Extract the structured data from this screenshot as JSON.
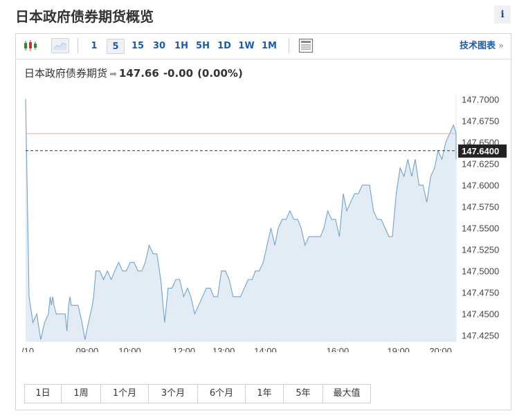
{
  "header": {
    "title": "日本政府债券期货概览",
    "info_label": "i"
  },
  "toolbar": {
    "timeframes": [
      "1",
      "5",
      "15",
      "30",
      "1H",
      "5H",
      "1D",
      "1W",
      "1M"
    ],
    "active_timeframe": "5",
    "tech_chart_label": "技术图表",
    "tech_chart_arrow": "»"
  },
  "quote": {
    "name": "日本政府债券期货",
    "arrow": "➡",
    "price": "147.66",
    "change": "-0.00",
    "change_pct": "(0.00%)"
  },
  "ranges": [
    "1日",
    "1周",
    "1个月",
    "3个月",
    "6个月",
    "1年",
    "5年",
    "最大值"
  ],
  "colors": {
    "line": "#6fa3cc",
    "area": "#e3ecf5",
    "prev_close_line": "#f3a5a5",
    "current_line": "#333333",
    "current_badge_bg": "#222222",
    "accent": "#1d5aa8"
  },
  "chart_data": {
    "type": "area",
    "y_ticks": [
      "147.7000",
      "147.6750",
      "147.6500",
      "147.6250",
      "147.6000",
      "147.5750",
      "147.5500",
      "147.5250",
      "147.5000",
      "147.4750",
      "147.4500",
      "147.4250"
    ],
    "x_ticks": [
      {
        "label": "/10",
        "t": 0
      },
      {
        "label": "09:00",
        "t": 14.3
      },
      {
        "label": "10:00",
        "t": 24.2
      },
      {
        "label": "12:00",
        "t": 36.8
      },
      {
        "label": "13:00",
        "t": 46.0
      },
      {
        "label": "14:00",
        "t": 55.7
      },
      {
        "label": "16:00",
        "t": 72.5
      },
      {
        "label": "19:00",
        "t": 86.6
      },
      {
        "label": "20:00",
        "t": 96.4
      }
    ],
    "ylim": [
      147.4175,
      147.7051
    ],
    "xlim": [
      0,
      100
    ],
    "current_value": 147.64,
    "current_label": "147.6400",
    "prev_close": 147.66,
    "values": [
      [
        0,
        147.7
      ],
      [
        0.8,
        147.47
      ],
      [
        1.7,
        147.44
      ],
      [
        2.6,
        147.45
      ],
      [
        3.5,
        147.42
      ],
      [
        4.4,
        147.44
      ],
      [
        5.3,
        147.45
      ],
      [
        5.7,
        147.47
      ],
      [
        6.0,
        147.46
      ],
      [
        6.3,
        147.47
      ],
      [
        6.6,
        147.46
      ],
      [
        7.1,
        147.45
      ],
      [
        8.3,
        147.45
      ],
      [
        9.2,
        147.45
      ],
      [
        9.6,
        147.43
      ],
      [
        10.0,
        147.46
      ],
      [
        10.3,
        147.47
      ],
      [
        10.6,
        147.46
      ],
      [
        11.4,
        147.46
      ],
      [
        12.2,
        147.46
      ],
      [
        13.1,
        147.44
      ],
      [
        13.8,
        147.42
      ],
      [
        14.6,
        147.44
      ],
      [
        15.5,
        147.46
      ],
      [
        15.8,
        147.47
      ],
      [
        16.3,
        147.5
      ],
      [
        17.2,
        147.5
      ],
      [
        18.1,
        147.49
      ],
      [
        19.0,
        147.5
      ],
      [
        19.9,
        147.49
      ],
      [
        20.7,
        147.5
      ],
      [
        21.6,
        147.51
      ],
      [
        22.5,
        147.5
      ],
      [
        23.4,
        147.5
      ],
      [
        24.3,
        147.51
      ],
      [
        25.2,
        147.51
      ],
      [
        26.1,
        147.5
      ],
      [
        27.0,
        147.5
      ],
      [
        27.8,
        147.51
      ],
      [
        28.7,
        147.53
      ],
      [
        29.6,
        147.52
      ],
      [
        30.5,
        147.52
      ],
      [
        31.4,
        147.49
      ],
      [
        32.3,
        147.44
      ],
      [
        33.1,
        147.48
      ],
      [
        34.0,
        147.48
      ],
      [
        34.9,
        147.49
      ],
      [
        35.8,
        147.49
      ],
      [
        36.7,
        147.47
      ],
      [
        37.6,
        147.48
      ],
      [
        38.4,
        147.47
      ],
      [
        39.3,
        147.45
      ],
      [
        40.2,
        147.46
      ],
      [
        41.1,
        147.47
      ],
      [
        42.0,
        147.48
      ],
      [
        42.9,
        147.48
      ],
      [
        43.7,
        147.47
      ],
      [
        44.6,
        147.47
      ],
      [
        45.5,
        147.5
      ],
      [
        46.4,
        147.5
      ],
      [
        47.3,
        147.49
      ],
      [
        48.2,
        147.47
      ],
      [
        49.0,
        147.47
      ],
      [
        49.9,
        147.47
      ],
      [
        50.8,
        147.48
      ],
      [
        51.7,
        147.49
      ],
      [
        52.6,
        147.49
      ],
      [
        53.4,
        147.5
      ],
      [
        54.3,
        147.5
      ],
      [
        55.2,
        147.51
      ],
      [
        56.1,
        147.53
      ],
      [
        57.0,
        147.55
      ],
      [
        57.9,
        147.53
      ],
      [
        58.7,
        147.55
      ],
      [
        59.6,
        147.56
      ],
      [
        60.5,
        147.56
      ],
      [
        61.4,
        147.57
      ],
      [
        62.3,
        147.56
      ],
      [
        63.2,
        147.56
      ],
      [
        64.0,
        147.55
      ],
      [
        64.9,
        147.53
      ],
      [
        65.8,
        147.54
      ],
      [
        66.7,
        147.54
      ],
      [
        67.6,
        147.54
      ],
      [
        68.5,
        147.54
      ],
      [
        69.3,
        147.55
      ],
      [
        70.2,
        147.57
      ],
      [
        71.1,
        147.56
      ],
      [
        72.0,
        147.56
      ],
      [
        72.9,
        147.54
      ],
      [
        73.8,
        147.59
      ],
      [
        74.6,
        147.57
      ],
      [
        75.5,
        147.58
      ],
      [
        76.4,
        147.59
      ],
      [
        77.3,
        147.59
      ],
      [
        78.2,
        147.6
      ],
      [
        79.1,
        147.6
      ],
      [
        79.9,
        147.6
      ],
      [
        80.8,
        147.57
      ],
      [
        81.7,
        147.56
      ],
      [
        82.6,
        147.56
      ],
      [
        83.5,
        147.55
      ],
      [
        84.4,
        147.54
      ],
      [
        85.2,
        147.54
      ],
      [
        86.1,
        147.59
      ],
      [
        87.0,
        147.62
      ],
      [
        87.9,
        147.61
      ],
      [
        88.8,
        147.63
      ],
      [
        89.7,
        147.61
      ],
      [
        90.5,
        147.63
      ],
      [
        91.4,
        147.6
      ],
      [
        92.3,
        147.6
      ],
      [
        93.2,
        147.58
      ],
      [
        94.1,
        147.61
      ],
      [
        95.0,
        147.62
      ],
      [
        95.8,
        147.64
      ],
      [
        96.7,
        147.63
      ],
      [
        97.6,
        147.65
      ],
      [
        98.5,
        147.66
      ],
      [
        99.4,
        147.67
      ],
      [
        100.0,
        147.66
      ],
      [
        100.9,
        147.65
      ],
      [
        101.8,
        147.66
      ],
      [
        102.6,
        147.63
      ],
      [
        103.5,
        147.64
      ],
      [
        104.4,
        147.64
      ]
    ]
  }
}
